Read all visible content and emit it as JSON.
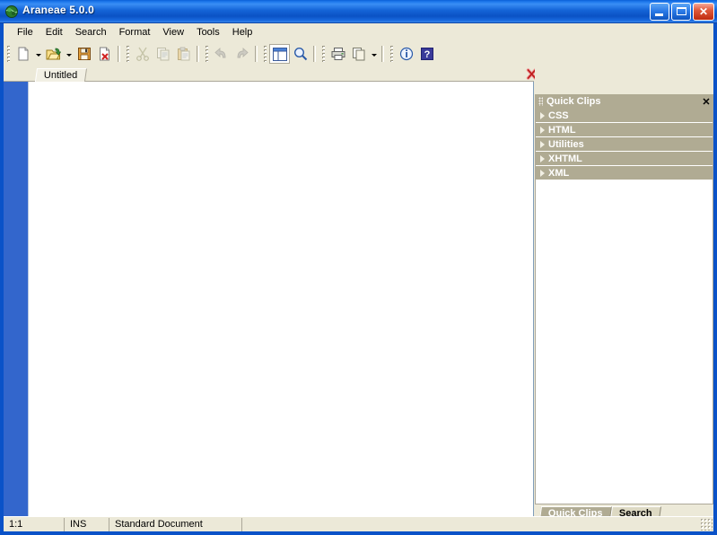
{
  "window": {
    "title": "Araneae 5.0.0",
    "icon": "spider-globe-icon",
    "controls": {
      "minimize": "minimize-button",
      "maximize": "maximize-button",
      "close_glyph": "✕"
    }
  },
  "menubar": {
    "items": [
      {
        "label": "File"
      },
      {
        "label": "Edit"
      },
      {
        "label": "Search"
      },
      {
        "label": "Format"
      },
      {
        "label": "View"
      },
      {
        "label": "Tools"
      },
      {
        "label": "Help"
      }
    ]
  },
  "toolbar": {
    "groups": [
      {
        "buttons": [
          {
            "name": "new-document-button",
            "icon": "new-page-icon",
            "dropdown": true,
            "disabled": false
          },
          {
            "name": "open-document-button",
            "icon": "open-folder-icon",
            "dropdown": true,
            "disabled": false
          },
          {
            "name": "save-document-button",
            "icon": "save-floppy-icon",
            "dropdown": false,
            "disabled": false
          },
          {
            "name": "close-document-button",
            "icon": "page-delete-icon",
            "dropdown": false,
            "disabled": false
          }
        ]
      },
      {
        "buttons": [
          {
            "name": "cut-button",
            "icon": "scissors-icon",
            "dropdown": false,
            "disabled": true
          },
          {
            "name": "copy-button",
            "icon": "copy-pages-icon",
            "dropdown": false,
            "disabled": true
          },
          {
            "name": "paste-button",
            "icon": "clipboard-paste-icon",
            "dropdown": false,
            "disabled": true
          }
        ]
      },
      {
        "buttons": [
          {
            "name": "undo-button",
            "icon": "undo-arrow-icon",
            "dropdown": false,
            "disabled": true
          },
          {
            "name": "redo-button",
            "icon": "redo-arrow-icon",
            "dropdown": false,
            "disabled": true
          }
        ]
      },
      {
        "buttons": [
          {
            "name": "toggle-panel-button",
            "icon": "split-window-icon",
            "dropdown": false,
            "pressed": true,
            "disabled": false
          },
          {
            "name": "preview-button",
            "icon": "magnifier-icon",
            "dropdown": false,
            "disabled": false
          }
        ]
      },
      {
        "buttons": [
          {
            "name": "print-button",
            "icon": "printer-icon",
            "dropdown": false,
            "disabled": false
          },
          {
            "name": "print-preview-button",
            "icon": "pages-icon",
            "dropdown": true,
            "disabled": false
          }
        ]
      },
      {
        "buttons": [
          {
            "name": "info-button",
            "icon": "info-circle-icon",
            "dropdown": false,
            "disabled": false
          },
          {
            "name": "help-button",
            "icon": "help-question-icon",
            "dropdown": false,
            "disabled": false
          }
        ]
      }
    ]
  },
  "document_tabs": {
    "tabs": [
      {
        "label": "Untitled",
        "active": true
      }
    ],
    "close_icon": "red-x-close-icon"
  },
  "editor": {
    "content": "",
    "gutter_color": "#3366cc"
  },
  "dock_panel": {
    "title": "Quick Clips",
    "close_label": "✕",
    "categories": [
      {
        "label": "CSS",
        "expanded": false
      },
      {
        "label": "HTML",
        "expanded": false
      },
      {
        "label": "Utilities",
        "expanded": false
      },
      {
        "label": "XHTML",
        "expanded": false
      },
      {
        "label": "XML",
        "expanded": false
      }
    ],
    "tabs": [
      {
        "label": "Quick Clips",
        "active": true
      },
      {
        "label": "Search",
        "active": false
      }
    ]
  },
  "statusbar": {
    "cursor_position": "1:1",
    "insert_mode": "INS",
    "document_type": "Standard Document",
    "extra": ""
  },
  "colors": {
    "title_blue": "#0a52c8",
    "window_face": "#ece9d8",
    "panel_header": "#b0ab93",
    "gutter_blue": "#3366cc",
    "close_red": "#cc2b1d"
  }
}
